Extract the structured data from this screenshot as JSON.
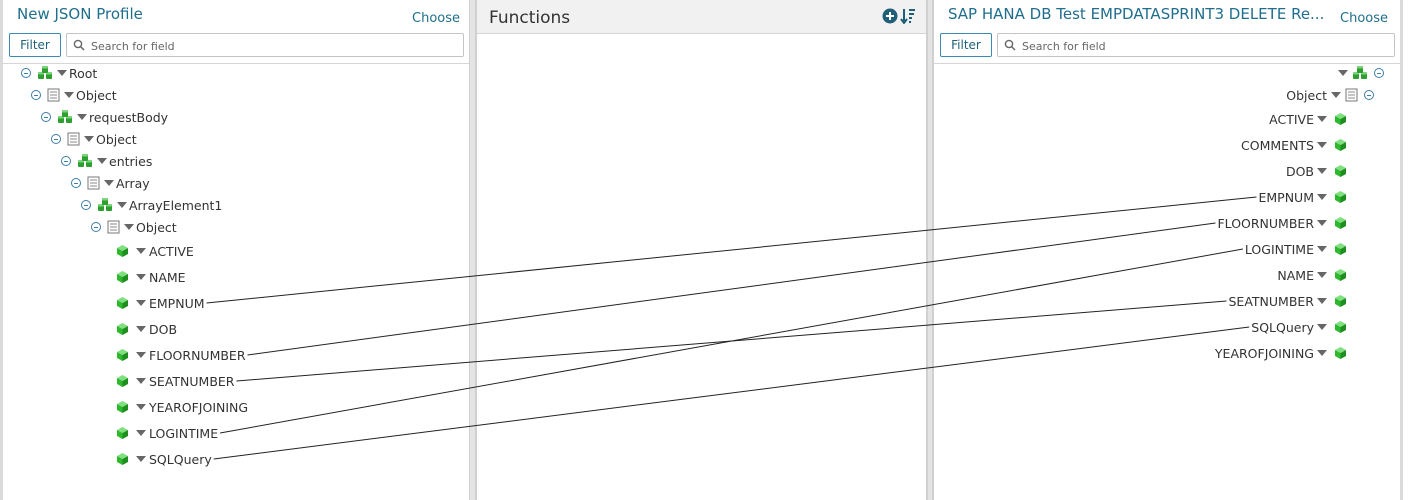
{
  "left": {
    "title": "New JSON Profile",
    "choose_label": "Choose",
    "filter_label": "Filter",
    "search_placeholder": "Search for field",
    "tree": [
      {
        "label": "Root",
        "icon": "cubes-icon"
      },
      {
        "label": "Object",
        "icon": "document-icon"
      },
      {
        "label": "requestBody",
        "icon": "cubes-icon"
      },
      {
        "label": "Object",
        "icon": "document-icon"
      },
      {
        "label": "entries",
        "icon": "cubes-icon"
      },
      {
        "label": "Array",
        "icon": "document-icon"
      },
      {
        "label": "ArrayElement1",
        "icon": "cubes-icon"
      },
      {
        "label": "Object",
        "icon": "document-icon"
      }
    ],
    "fields": [
      "ACTIVE",
      "NAME",
      "EMPNUM",
      "DOB",
      "FLOORNUMBER",
      "SEATNUMBER",
      "YEAROFJOINING",
      "LOGINTIME",
      "SQLQuery"
    ]
  },
  "functions": {
    "title": "Functions",
    "icons": [
      "add-circle-icon",
      "sort-icon"
    ]
  },
  "right": {
    "title": "SAP HANA DB Test EMPDATASPRINT3 DELETE Re...",
    "choose_label": "Choose",
    "filter_label": "Filter",
    "search_placeholder": "Search for field",
    "object_label": "Object",
    "fields": [
      "ACTIVE",
      "COMMENTS",
      "DOB",
      "EMPNUM",
      "FLOORNUMBER",
      "LOGINTIME",
      "NAME",
      "SEATNUMBER",
      "SQLQuery",
      "YEAROFJOINING"
    ]
  },
  "mappings": [
    {
      "from": "EMPNUM",
      "to": "EMPNUM"
    },
    {
      "from": "FLOORNUMBER",
      "to": "FLOORNUMBER"
    },
    {
      "from": "SEATNUMBER",
      "to": "SEATNUMBER"
    },
    {
      "from": "LOGINTIME",
      "to": "LOGINTIME"
    },
    {
      "from": "SQLQuery",
      "to": "SQLQuery"
    }
  ],
  "colors": {
    "accent": "#1f6e8c",
    "field_icon": "#2eb82e",
    "panel_border": "#d0d0d0"
  }
}
